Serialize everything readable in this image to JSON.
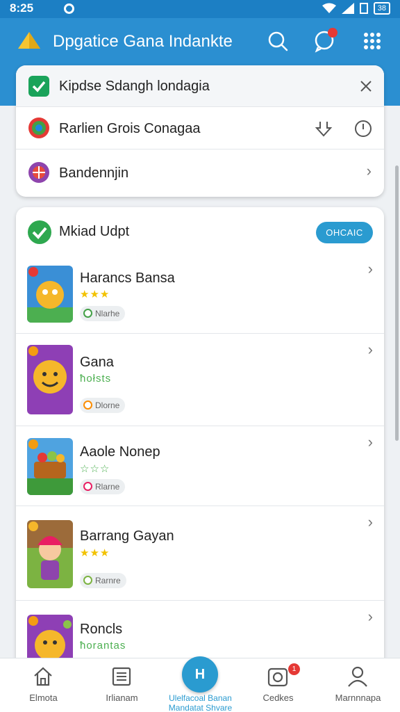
{
  "status": {
    "time": "8:25",
    "battery": "38"
  },
  "app": {
    "title": "Dpgatice Gana Indankte"
  },
  "menu": {
    "header": "Kipdse Sdangh londagia",
    "items": [
      {
        "label": "Rarlien Grois Conagaa"
      },
      {
        "label": "Bandennjin"
      }
    ]
  },
  "updates": {
    "title": "Mkiad Udpt",
    "action": "OHCAIC",
    "games": [
      {
        "name": "Harancs Bansa",
        "stars": "★★★",
        "tag": "Nlarhe",
        "star_color": "#f2c200",
        "tag_color": "#43a047"
      },
      {
        "name": "Gana",
        "stars": "ħołsts",
        "tag": "Dlorne",
        "star_color": "#4caf50",
        "tag_color": "#fb8c00"
      },
      {
        "name": "Aaole Nonep",
        "stars": "☆☆☆",
        "tag": "Rlarne",
        "star_color": "#4caf50",
        "tag_color": "#e91e63"
      },
      {
        "name": "Barrang Gayan",
        "stars": "★★★",
        "tag": "Rarnre",
        "star_color": "#f2c200",
        "tag_color": "#7cb342"
      },
      {
        "name": "Roncls",
        "stars": "ħorantas",
        "tag": "",
        "star_color": "#4caf50",
        "tag_color": "#43a047"
      }
    ]
  },
  "nav": {
    "items": [
      {
        "label": "Elmota"
      },
      {
        "label": "Irlianam"
      },
      {
        "label": "Ulelfacoal Banan Mandatat Shvare"
      },
      {
        "label": "Cedkes"
      },
      {
        "label": "Marnnnapa"
      }
    ],
    "fab": "H",
    "notif": "1"
  },
  "colors": {
    "accent": "#2a9bd0",
    "appbar": "#2b8fd1",
    "badge": "#e53935"
  }
}
